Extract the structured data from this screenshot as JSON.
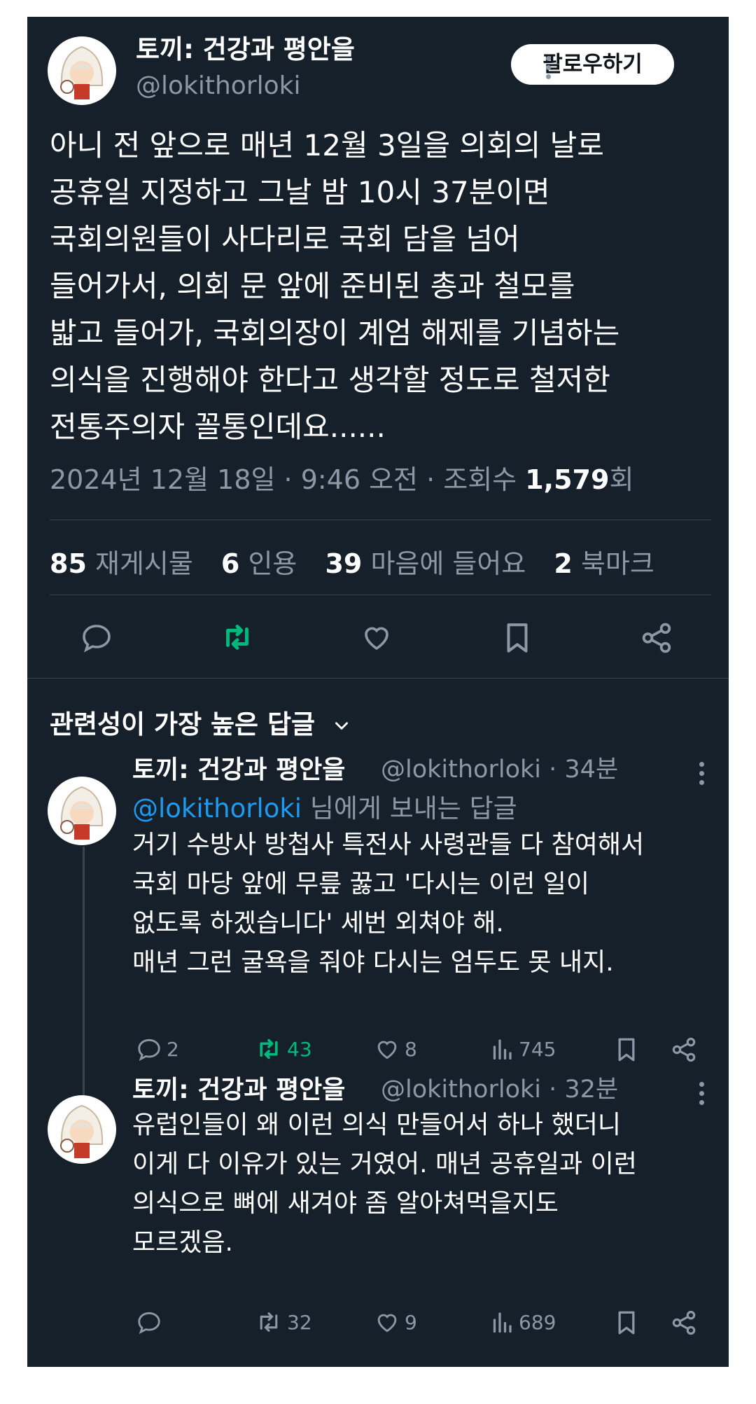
{
  "colors": {
    "background": "#15202b",
    "accent": "#1d9bf0",
    "retweet_active": "#00ba7c",
    "muted": "#8b98a5"
  },
  "tweet": {
    "author_name": "토끼: 건강과 평안을",
    "author_handle": "@lokithorloki",
    "follow_label": "팔로우하기",
    "text": "아니 전 앞으로 매년 12월 3일을 의회의 날로\n공휴일 지정하고 그날 밤 10시 37분이면\n국회의원들이 사다리로 국회 담을 넘어\n들어가서, 의회 문 앞에 준비된 총과 철모를\n밟고 들어가, 국회의장이 계엄 해제를 기념하는\n의식을 진행해야 한다고 생각할 정도로 철저한\n전통주의자 꼴통인데요......",
    "date": "2024년 12월 18일 · 9:46 오전 · 조회수 ",
    "views": "1,579",
    "views_suffix": "회",
    "stats": [
      {
        "count": "85",
        "label": "재게시물"
      },
      {
        "count": "6",
        "label": "인용"
      },
      {
        "count": "39",
        "label": "마음에 들어요"
      },
      {
        "count": "2",
        "label": "북마크"
      }
    ]
  },
  "sort_label": "관련성이 가장 높은 답글",
  "replies": [
    {
      "author_name": "토끼: 건강과 평안을",
      "handle_time": "@lokithorloki · 34분",
      "replying_to": "@lokithorloki",
      "replying_suffix": " 님에게 보내는 답글",
      "text": "거기 수방사 방첩사 특전사 사령관들 다 참여해서\n국회 마당 앞에 무릎 꿇고 '다시는 이런 일이\n없도록 하겠습니다' 세번 외쳐야 해.\n매년 그런 굴욕을 줘야 다시는 엄두도 못 내지.",
      "replies": "2",
      "retweets": "43",
      "likes": "8",
      "views": "745"
    },
    {
      "author_name": "토끼: 건강과 평안을",
      "handle_time": "@lokithorloki · 32분",
      "text": "유럽인들이 왜 이런 의식 만들어서 하나 했더니\n이게 다 이유가 있는 거였어. 매년 공휴일과 이런\n의식으로 뼈에 새겨야 좀 알아쳐먹을지도\n모르겠음.",
      "replies": "",
      "retweets": "32",
      "likes": "9",
      "views": "689"
    }
  ]
}
